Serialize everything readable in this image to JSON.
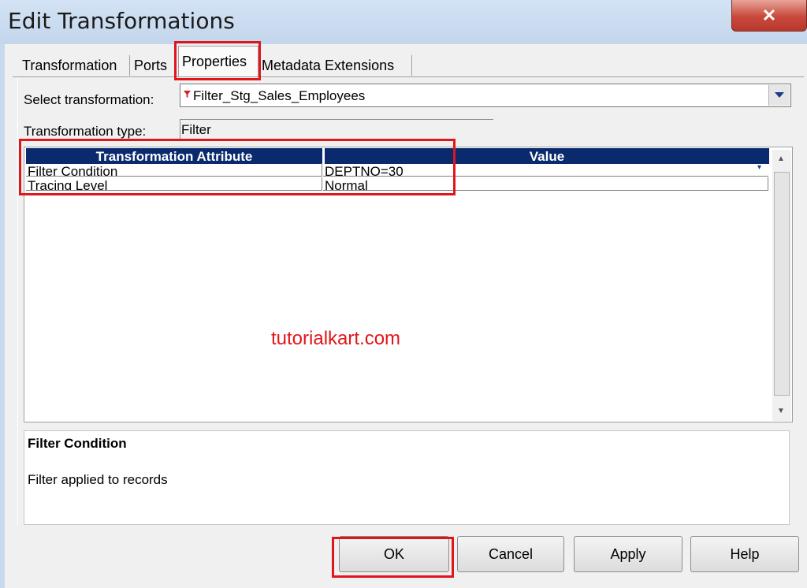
{
  "window": {
    "title": "Edit Transformations",
    "close_glyph": "✕"
  },
  "tabs": [
    {
      "label": "Transformation"
    },
    {
      "label": "Ports"
    },
    {
      "label": "Properties"
    },
    {
      "label": "Metadata Extensions"
    }
  ],
  "form": {
    "select_label": "Select transformation:",
    "select_value": "Filter_Stg_Sales_Employees",
    "type_label": "Transformation type:",
    "type_value": "Filter"
  },
  "grid": {
    "columns": [
      "Transformation Attribute",
      "Value"
    ],
    "rows": [
      {
        "attribute": "Filter Condition",
        "value": "DEPTNO=30"
      },
      {
        "attribute": "Tracing Level",
        "value": "Normal"
      }
    ]
  },
  "watermark": "tutorialkart.com",
  "description": {
    "title": "Filter Condition",
    "text": "Filter applied to records"
  },
  "buttons": {
    "ok": "OK",
    "cancel": "Cancel",
    "apply": "Apply",
    "help": "Help"
  },
  "colors": {
    "header_bg": "#0a2a6e",
    "highlight": "#e0161b",
    "close_btn": "#c9483b"
  }
}
